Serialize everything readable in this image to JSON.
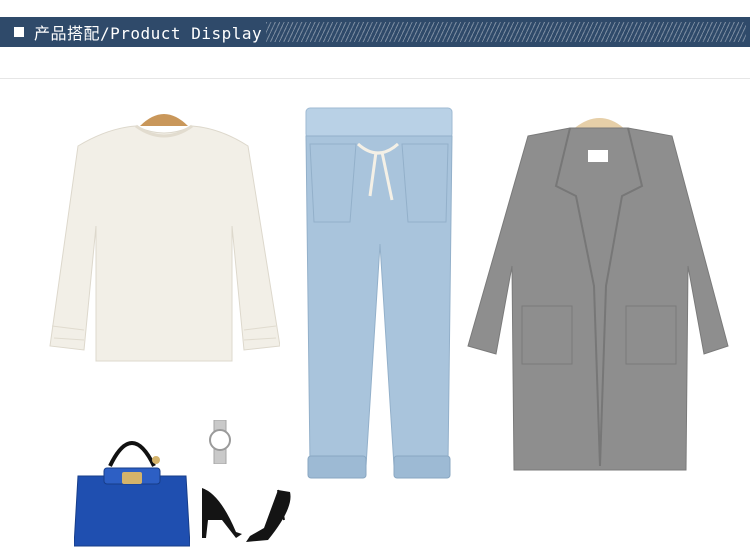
{
  "header": {
    "title": "产品搭配/Product Display",
    "bar_color": "#2f4a6a"
  },
  "products": [
    {
      "name": "sweater",
      "color": "#f2efe7",
      "icon": "hanger-icon"
    },
    {
      "name": "jeans",
      "color": "#a9c4dc"
    },
    {
      "name": "coat",
      "color": "#8e8e8e",
      "icon": "hanger-icon"
    },
    {
      "name": "handbag",
      "color": "#1f4fb0"
    },
    {
      "name": "watch",
      "color": "#c9c9c9"
    },
    {
      "name": "heels",
      "color": "#141414"
    }
  ]
}
